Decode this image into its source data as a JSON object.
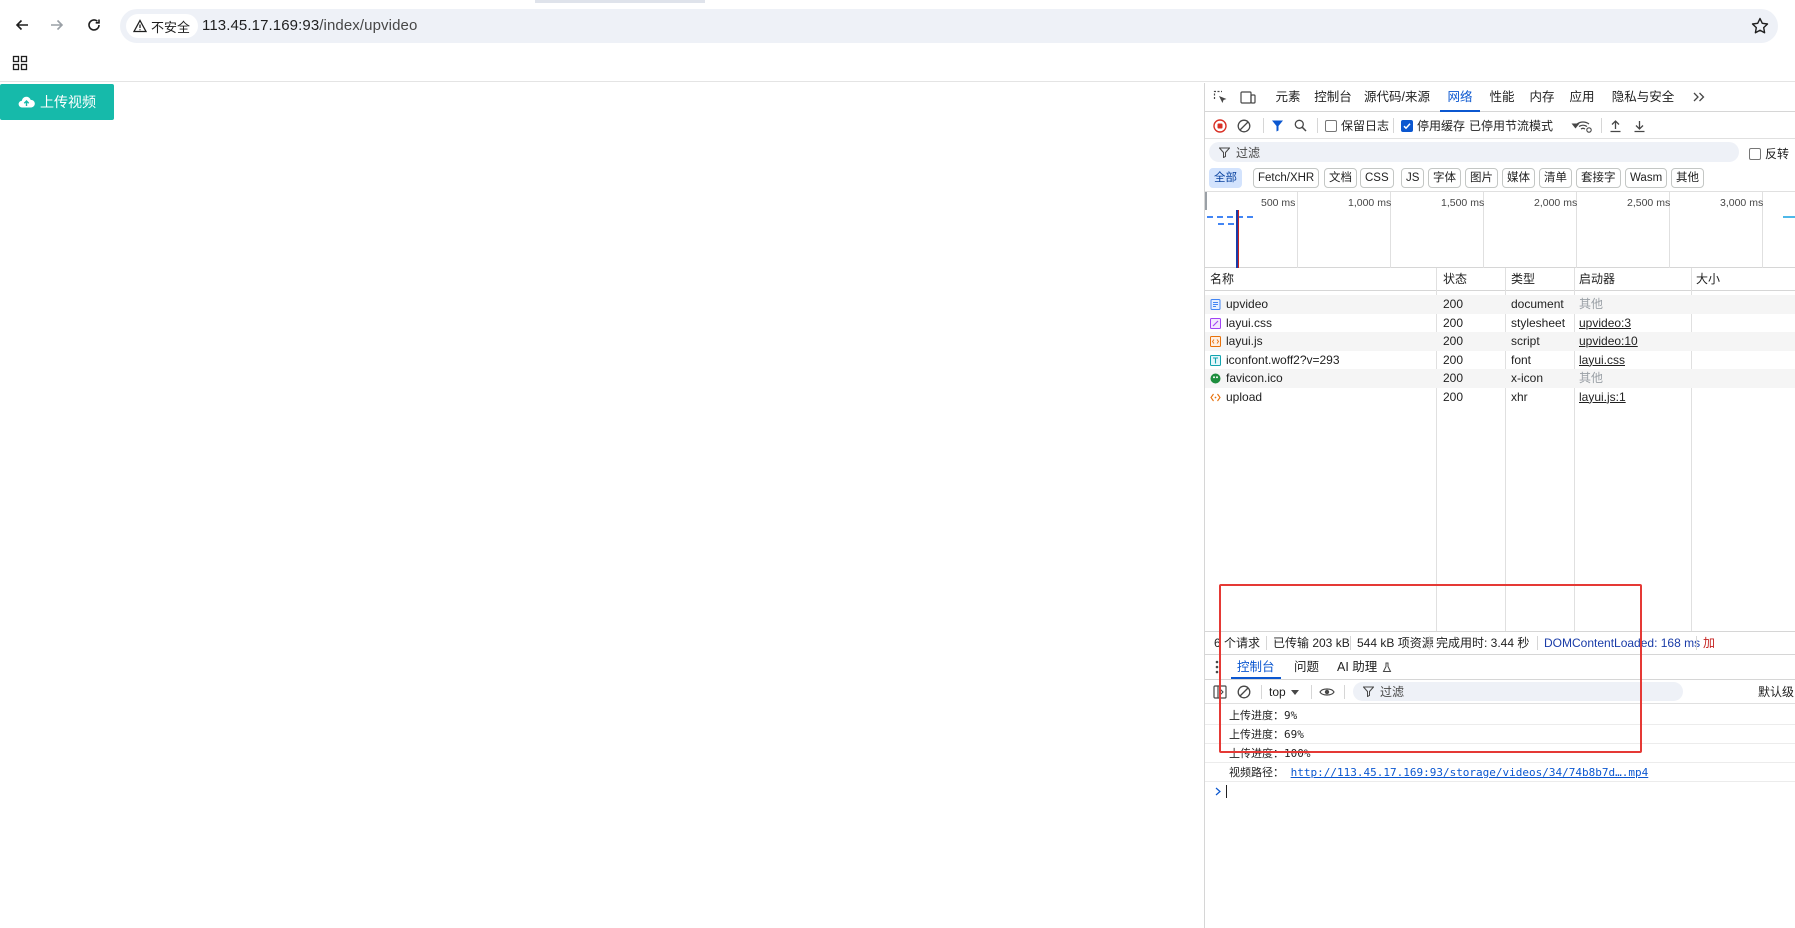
{
  "browser": {
    "security_label": "不安全",
    "url_host": "113.45.17.169:93",
    "url_path": "/index/upvideo"
  },
  "page": {
    "upload_button_label": "上传视频",
    "upload_button_color": "#16baaa"
  },
  "devtools": {
    "tabs": [
      "元素",
      "控制台",
      "源代码/来源",
      "网络",
      "性能",
      "内存",
      "应用",
      "隐私与安全"
    ],
    "active_tab": "网络",
    "network_toolbar": {
      "preserve_log_label": "保留日志",
      "preserve_log_checked": false,
      "disable_cache_label": "停用缓存",
      "disable_cache_checked": true,
      "throttling_label": "已停用节流模式"
    },
    "filter_placeholder": "过滤",
    "invert_label": "反转",
    "type_filters": [
      "全部",
      "Fetch/XHR",
      "文档",
      "CSS",
      "JS",
      "字体",
      "图片",
      "媒体",
      "清单",
      "套接字",
      "Wasm",
      "其他"
    ],
    "active_type_filter": "全部",
    "timeline_labels": [
      "500 ms",
      "1,000 ms",
      "1,500 ms",
      "2,000 ms",
      "2,500 ms",
      "3,000 ms"
    ],
    "columns": [
      "名称",
      "状态",
      "类型",
      "启动器",
      "大小"
    ],
    "requests": [
      {
        "name": "upvideo",
        "status": "200",
        "type": "document",
        "initiator": "其他",
        "initiator_link": false,
        "icon": "document-icon"
      },
      {
        "name": "layui.css",
        "status": "200",
        "type": "stylesheet",
        "initiator": "upvideo:3",
        "initiator_link": true,
        "icon": "stylesheet-icon"
      },
      {
        "name": "layui.js",
        "status": "200",
        "type": "script",
        "initiator": "upvideo:10",
        "initiator_link": true,
        "icon": "script-icon"
      },
      {
        "name": "iconfont.woff2?v=293",
        "status": "200",
        "type": "font",
        "initiator": "layui.css",
        "initiator_link": true,
        "icon": "font-icon"
      },
      {
        "name": "favicon.ico",
        "status": "200",
        "type": "x-icon",
        "initiator": "其他",
        "initiator_link": false,
        "icon": "image-icon"
      },
      {
        "name": "upload",
        "status": "200",
        "type": "xhr",
        "initiator": "layui.js:1",
        "initiator_link": true,
        "icon": "xhr-icon"
      }
    ],
    "summary": {
      "requests": "6 个请求",
      "transferred": "已传输 203 kB",
      "resources": "544 kB 项资源",
      "finish": "完成用时: 3.44 秒",
      "dom_content_loaded": "DOMContentLoaded: 168 ms",
      "load_cut": "加"
    },
    "drawer_tabs": [
      "控制台",
      "问题",
      "AI 助理"
    ],
    "active_drawer_tab": "控制台",
    "console_context": "top",
    "console_filter_placeholder": "过滤",
    "console_levels_cut": "默认级",
    "console_logs": [
      {
        "text": "上传进度：9%"
      },
      {
        "text": "上传进度：69%"
      },
      {
        "text": "上传进度：100%"
      },
      {
        "text": "视频路径：",
        "link": "http://113.45.17.169:93/storage/videos/34/74b8b7d….mp4"
      }
    ],
    "highlight_color": "#e53935"
  }
}
